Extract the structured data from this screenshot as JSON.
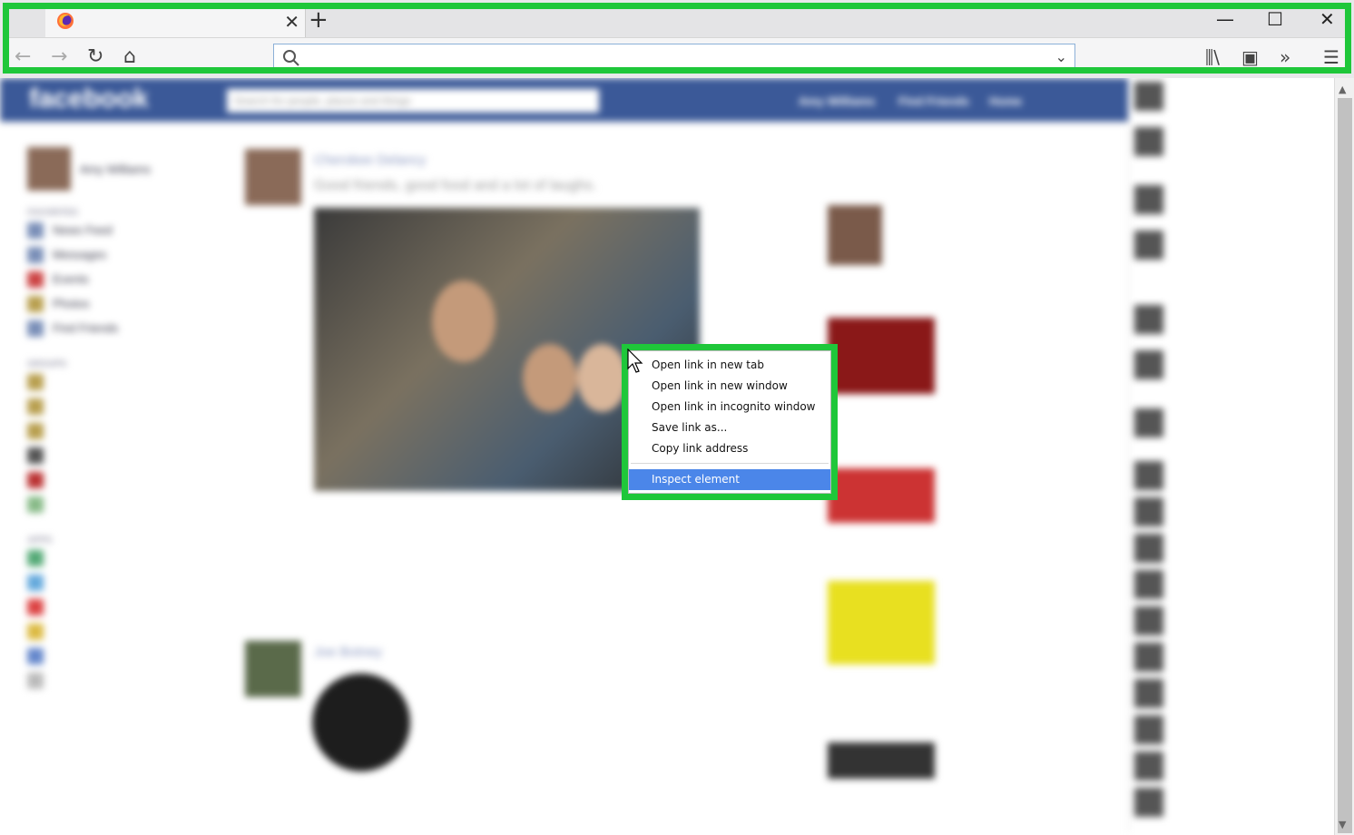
{
  "browser": {
    "tab_title": "",
    "new_tab_label": "+",
    "tab_close": "✕",
    "window_controls": {
      "minimize": "—",
      "maximize": "☐",
      "close": "✕"
    },
    "nav": {
      "back": "←",
      "forward": "→",
      "reload": "↻",
      "home": "⌂"
    },
    "url_value": "",
    "url_dropdown": "⌄",
    "toolbar_icons": {
      "library": "⫼\\",
      "sidebar": "▣",
      "overflow": "»",
      "menu": "☰"
    },
    "accent_color": "#1fc73a"
  },
  "page_bg": {
    "brand": "facebook",
    "search_placeholder": "Search for people, places and things",
    "user_name": "Amy Williams",
    "nav_links": [
      "Find Friends",
      "Home"
    ],
    "post1_author": "Cherokee Delancy",
    "post1_text": "Good friends, good food and a lot of laughs.",
    "post2_author": "Joe Botney",
    "sidebar_favorites": [
      "News Feed",
      "Messages",
      "Events",
      "Photos",
      "Find Friends"
    ]
  },
  "context_menu": {
    "items": [
      "Open link in new tab",
      "Open link in new window",
      "Open link in incognito window",
      "Save link as...",
      "Copy link address"
    ],
    "highlighted_item": "Inspect element",
    "highlight_color": "#4b86e9"
  }
}
